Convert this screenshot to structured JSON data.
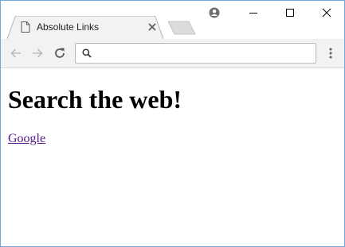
{
  "browser": {
    "tab": {
      "title": "Absolute Links"
    },
    "omnibox": {
      "value": "",
      "placeholder": ""
    }
  },
  "page": {
    "heading": "Search the web!",
    "link_text": "Google"
  },
  "colors": {
    "link_visited": "#551a8b",
    "window_border": "#6fa8dc",
    "toolbar_bg": "#f2f2f2"
  },
  "icons": [
    "document-icon",
    "close-tab-icon",
    "new-tab-icon",
    "profile-icon",
    "minimize-icon",
    "maximize-icon",
    "close-window-icon",
    "back-arrow-icon",
    "forward-arrow-icon",
    "reload-icon",
    "search-icon",
    "menu-kebab-icon"
  ]
}
